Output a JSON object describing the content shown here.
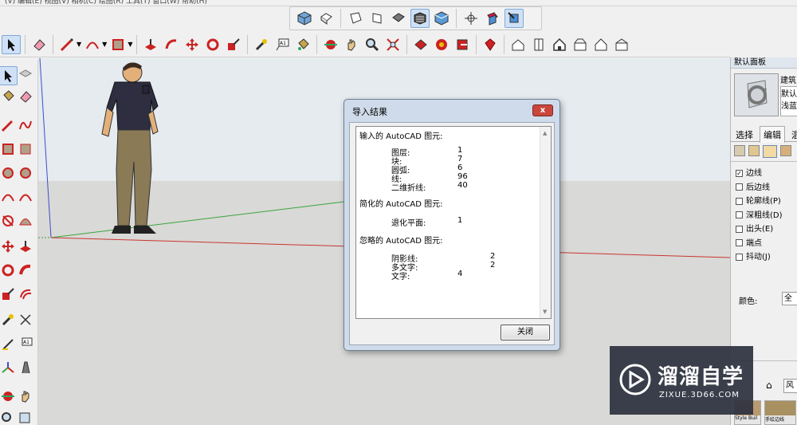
{
  "menubar": {
    "text": "(V)   编辑(E)   视图(V)   相机(C)   绘图(R)   工具(T)   窗口(W)   帮助(H)"
  },
  "dialog": {
    "title": "导入结果",
    "close_glyph": "x",
    "ok_label": "关闭",
    "imported_header": "输入的 AutoCAD 图元:",
    "imported": [
      {
        "label": "图层:",
        "value": "1"
      },
      {
        "label": "块:",
        "value": "7"
      },
      {
        "label": "圆弧:",
        "value": "6"
      },
      {
        "label": "线:",
        "value": "96"
      },
      {
        "label": "二维折线:",
        "value": "40"
      }
    ],
    "simplified_header": "简化的 AutoCAD 图元:",
    "simplified": [
      {
        "label": "退化平面:",
        "value": "1"
      }
    ],
    "ignored_header": "忽略的 AutoCAD 图元:",
    "ignored": [
      {
        "label": "阴影线:",
        "value": "2"
      },
      {
        "label": "多文字:",
        "value": "2"
      },
      {
        "label": "文字:",
        "value": "4"
      }
    ]
  },
  "right_panel": {
    "title": "默认面板",
    "style_name": "建筑",
    "style_desc_1": "默认",
    "style_desc_2": "浅蓝",
    "style_desc_3": "。",
    "tabs": [
      "选择",
      "编辑",
      "混"
    ],
    "checkboxes": [
      {
        "label": "边线",
        "checked": true
      },
      {
        "label": "后边线",
        "checked": false
      },
      {
        "label": "轮廓线(P)",
        "checked": false
      },
      {
        "label": "深粗线(D)",
        "checked": false
      },
      {
        "label": "出头(E)",
        "checked": false
      },
      {
        "label": "端点",
        "checked": false
      },
      {
        "label": "抖动(J)",
        "checked": false
      }
    ],
    "color_label": "颜色:",
    "color_value": "全部",
    "bottom_input": "风格",
    "thumb_label_1": "Style Buil",
    "thumb_label_2": "手绘边线"
  },
  "watermark": {
    "brand": "溜溜自学",
    "url": "ZIXUE.3D66.COM"
  },
  "colors": {
    "axis_red": "#c8362d",
    "axis_green": "#3aa43a",
    "axis_blue": "#3b4fc8",
    "dialog_frame": "#cfdbea",
    "watermark_bg": "#2d313f"
  }
}
